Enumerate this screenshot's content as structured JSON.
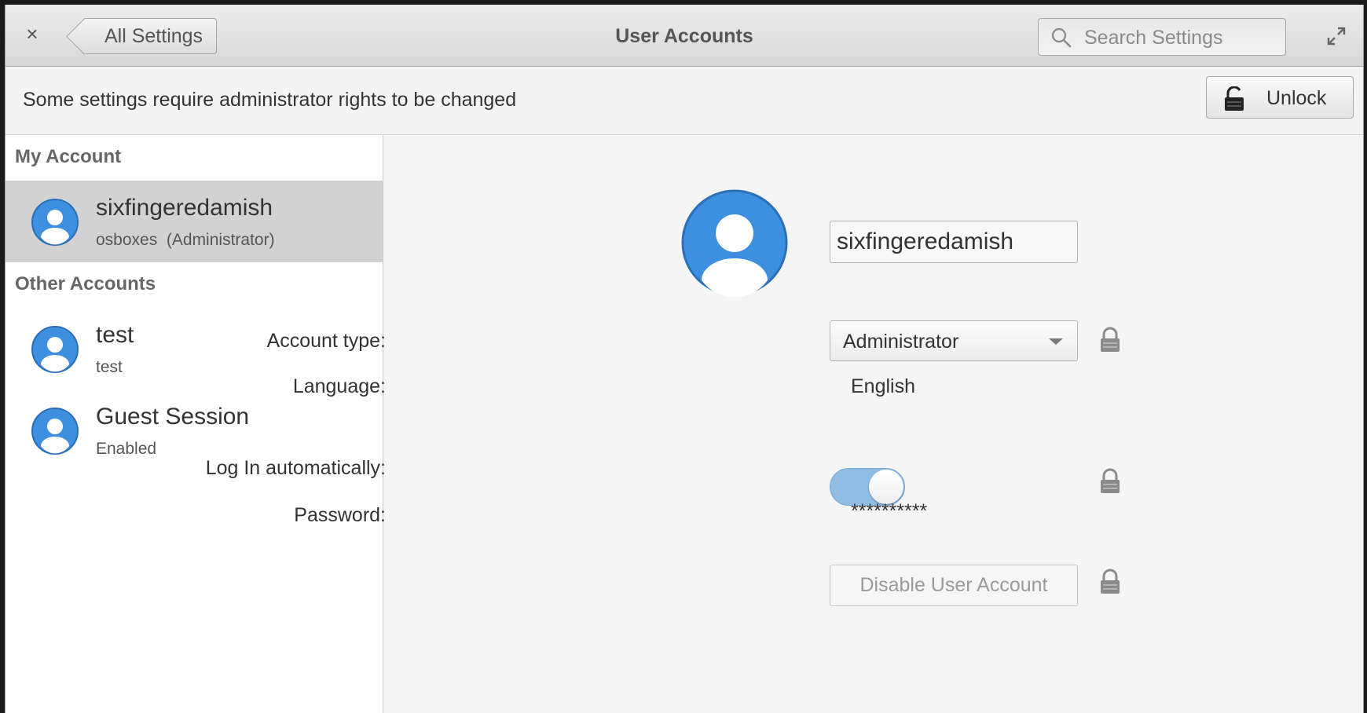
{
  "header": {
    "close_label": "×",
    "back_label": "All Settings",
    "title": "User Accounts",
    "search_placeholder": "Search Settings"
  },
  "infobar": {
    "message": "Some settings require administrator rights to be changed",
    "unlock_label": "Unlock"
  },
  "sidebar": {
    "my_account_header": "My Account",
    "other_accounts_header": "Other Accounts",
    "my_account": {
      "name": "sixfingeredamish",
      "sub": "osboxes  (Administrator)"
    },
    "other_accounts": [
      {
        "name": "test",
        "sub": "test"
      },
      {
        "name": "Guest Session",
        "sub": "Enabled"
      }
    ]
  },
  "main": {
    "full_name": "sixfingeredamish",
    "account_type_label": "Account type:",
    "account_type_value": "Administrator",
    "language_label": "Language:",
    "language_value": "English",
    "autologin_label": "Log In automatically:",
    "autologin_on": true,
    "password_label": "Password:",
    "password_value": "**********",
    "disable_label": "Disable User Account"
  },
  "colors": {
    "avatar_blue": "#3d8fe0",
    "toggle_on": "#90bde6",
    "selected_row": "#d2d2d2"
  },
  "icons": [
    "close-icon",
    "back-arrow-icon",
    "search-icon",
    "maximize-icon",
    "lock-open-icon",
    "lock-icon",
    "avatar-icon"
  ]
}
